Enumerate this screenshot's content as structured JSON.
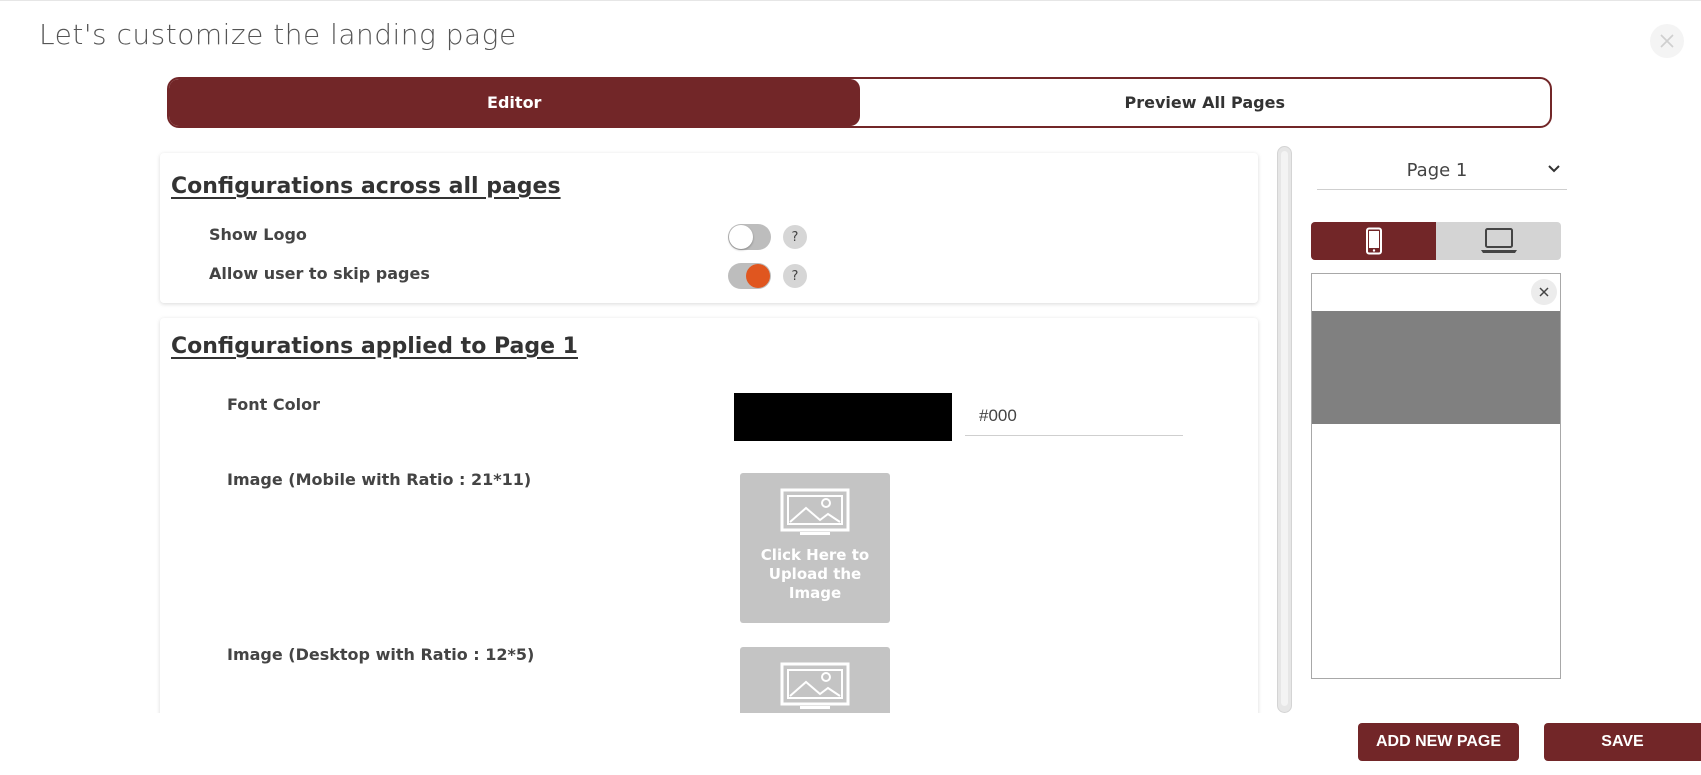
{
  "modal": {
    "title": "Let's customize the landing page"
  },
  "tabs": [
    {
      "label": "Editor",
      "active": true
    },
    {
      "label": "Preview All Pages",
      "active": false
    }
  ],
  "global_config": {
    "heading": "Configurations across all pages",
    "rows": [
      {
        "label": "Show Logo",
        "enabled": false,
        "help": "?"
      },
      {
        "label": "Allow user to skip pages",
        "enabled": true,
        "help": "?"
      }
    ]
  },
  "page_config": {
    "heading": "Configurations applied to Page 1",
    "font_color_label": "Font Color",
    "font_color_value": "#000",
    "image_mobile_label": "Image (Mobile with Ratio : 21*11)",
    "image_desktop_label": "Image (Desktop with Ratio : 12*5)",
    "upload_text": "Click Here to Upload the Image"
  },
  "sidebar": {
    "page_select": "Page 1",
    "device_selected": "mobile"
  },
  "footer": {
    "add_new_page": "ADD NEW PAGE",
    "save": "SAVE"
  },
  "colors": {
    "brand": "#722628",
    "toggle_on_knob": "#e0561f",
    "swatch": "#000000",
    "preview_banner": "#808080"
  }
}
